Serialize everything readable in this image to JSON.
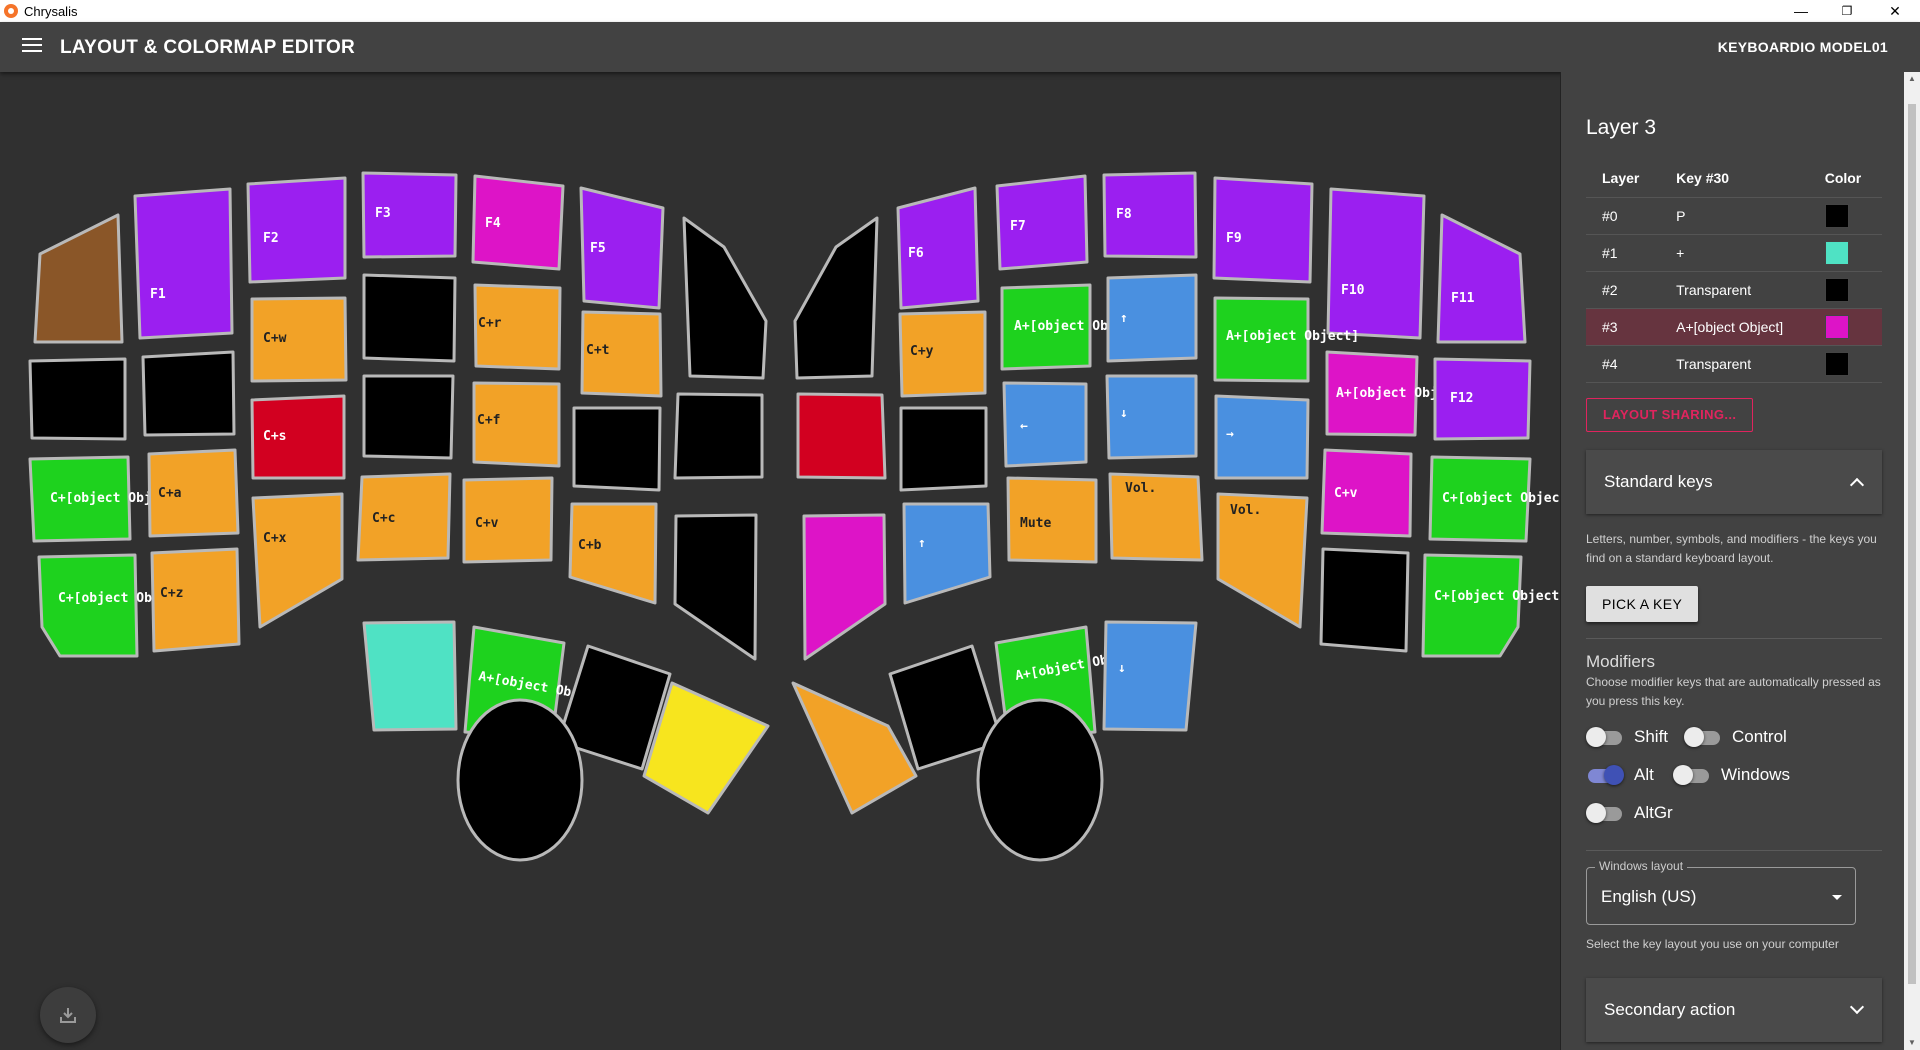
{
  "window": {
    "title": "Chrysalis",
    "minimize": "—",
    "restore": "❐",
    "close": "✕"
  },
  "appbar": {
    "title": "LAYOUT & COLORMAP EDITOR",
    "device": "KEYBOARDIO MODEL01"
  },
  "palette": {
    "brown": "#8a5628",
    "purple": "#9b1ff0",
    "magenta": "#dd14c7",
    "orange": "#f2a227",
    "black": "#000000",
    "red": "#d20020",
    "green": "#1ed21e",
    "blue": "#4a90e0",
    "teal": "#4fe2c4",
    "yellow": "#f7e51e"
  },
  "keys": [
    {
      "color": "brown",
      "label": ""
    },
    {
      "color": "purple",
      "label": "F1"
    },
    {
      "color": "purple",
      "label": "F2"
    },
    {
      "color": "purple",
      "label": "F3"
    },
    {
      "color": "magenta",
      "label": "F4"
    },
    {
      "color": "purple",
      "label": "F5"
    },
    {
      "color": "black",
      "label": ""
    },
    {
      "color": "black",
      "label": ""
    },
    {
      "color": "black",
      "label": ""
    },
    {
      "color": "orange",
      "label": "C+w"
    },
    {
      "color": "black",
      "label": ""
    },
    {
      "color": "orange",
      "label": "C+r"
    },
    {
      "color": "orange",
      "label": "C+t"
    },
    {
      "color": "red",
      "label": "C+s"
    },
    {
      "color": "black",
      "label": ""
    },
    {
      "color": "orange",
      "label": "C+f"
    },
    {
      "color": "black",
      "label": ""
    },
    {
      "color": "black",
      "label": ""
    },
    {
      "color": "green",
      "label": "C+[object Object]"
    },
    {
      "color": "orange",
      "label": "C+a"
    },
    {
      "color": "orange",
      "label": "C+x"
    },
    {
      "color": "orange",
      "label": "C+c"
    },
    {
      "color": "orange",
      "label": "C+v"
    },
    {
      "color": "orange",
      "label": "C+b"
    },
    {
      "color": "black",
      "label": ""
    },
    {
      "color": "green",
      "label": "C+[object Object]"
    },
    {
      "color": "orange",
      "label": "C+z"
    },
    {
      "color": "teal",
      "label": ""
    },
    {
      "color": "green",
      "label": "A+[object Object]"
    },
    {
      "color": "black",
      "label": ""
    },
    {
      "color": "yellow",
      "label": ""
    },
    {
      "color": "black",
      "label": ""
    },
    {
      "color": "black",
      "label": ""
    },
    {
      "color": "purple",
      "label": "F6"
    },
    {
      "color": "purple",
      "label": "F7"
    },
    {
      "color": "purple",
      "label": "F8"
    },
    {
      "color": "purple",
      "label": "F9"
    },
    {
      "color": "purple",
      "label": "F10"
    },
    {
      "color": "purple",
      "label": "F11"
    },
    {
      "color": "orange",
      "label": "C+y"
    },
    {
      "color": "green",
      "label": "A+[object Object]"
    },
    {
      "color": "blue",
      "label": "↑"
    },
    {
      "color": "green",
      "label": "A+[object Object]"
    },
    {
      "color": "red",
      "label": ""
    },
    {
      "color": "black",
      "label": ""
    },
    {
      "color": "blue",
      "label": "←"
    },
    {
      "color": "blue",
      "label": "↓"
    },
    {
      "color": "blue",
      "label": "→"
    },
    {
      "color": "magenta",
      "label": "A+[object Object]"
    },
    {
      "color": "purple",
      "label": "F12"
    },
    {
      "color": "magenta",
      "label": ""
    },
    {
      "color": "blue",
      "label": "↑"
    },
    {
      "color": "orange",
      "label": "Mute"
    },
    {
      "color": "orange",
      "label": "Vol."
    },
    {
      "color": "orange",
      "label": "Vol."
    },
    {
      "color": "magenta",
      "label": "C+v"
    },
    {
      "color": "green",
      "label": "C+[object Object]"
    },
    {
      "color": "black",
      "label": ""
    },
    {
      "color": "green",
      "label": "C+[object Object]"
    },
    {
      "color": "orange",
      "label": ""
    },
    {
      "color": "black",
      "label": ""
    },
    {
      "color": "green",
      "label": "A+[object Object]"
    },
    {
      "color": "blue",
      "label": "↓"
    },
    {
      "color": "black",
      "label": ""
    }
  ],
  "panel": {
    "layer_title": "Layer 3",
    "table_headers": [
      "Layer",
      "Key #30",
      "Color"
    ],
    "rows": [
      {
        "layer": "#0",
        "key": "P",
        "color": "#000000"
      },
      {
        "layer": "#1",
        "key": "+",
        "color": "#4fe2c4"
      },
      {
        "layer": "#2",
        "key": "Transparent",
        "color": "#000000"
      },
      {
        "layer": "#3",
        "key": "A+[object Object]",
        "color": "#dd14c7"
      },
      {
        "layer": "#4",
        "key": "Transparent",
        "color": "#000000"
      }
    ],
    "share_label": "LAYOUT SHARING...",
    "standard_keys": {
      "title": "Standard keys",
      "desc": "Letters, number, symbols, and modifiers - the keys you find on a standard keyboard layout.",
      "pick": "PICK A KEY"
    },
    "modifiers": {
      "title": "Modifiers",
      "desc": "Choose modifier keys that are automatically pressed as you press this key.",
      "shift": "Shift",
      "control": "Control",
      "alt": "Alt",
      "windows": "Windows",
      "altgr": "AltGr"
    },
    "layout_select": {
      "legend": "Windows layout",
      "value": "English (US)",
      "hint": "Select the key layout you use on your computer"
    },
    "secondary": {
      "title": "Secondary action"
    }
  }
}
